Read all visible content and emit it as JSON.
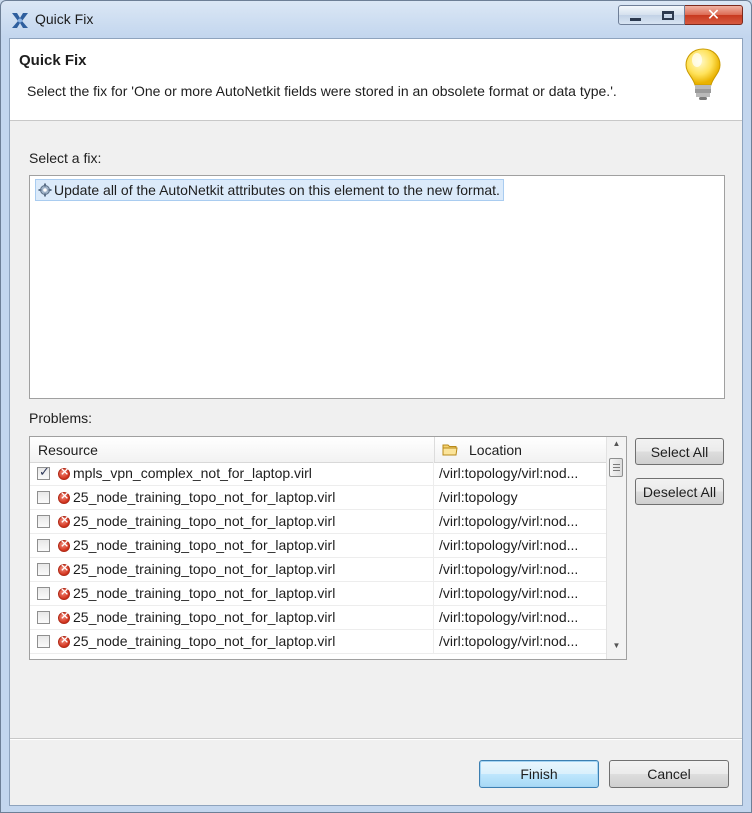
{
  "window": {
    "title": "Quick Fix"
  },
  "header": {
    "title": "Quick Fix",
    "description": "Select the fix for 'One or more AutoNetkit fields were stored in an obsolete format or data type.'."
  },
  "fixes": {
    "label": "Select a fix:",
    "items": [
      {
        "label": "Update all of the AutoNetkit attributes on this element to the new format.",
        "selected": true
      }
    ]
  },
  "problems": {
    "label": "Problems:",
    "columns": {
      "resource": "Resource",
      "location": "Location"
    },
    "rows": [
      {
        "checked": true,
        "resource": "mpls_vpn_complex_not_for_laptop.virl",
        "location": "/virl:topology/virl:nod..."
      },
      {
        "checked": false,
        "resource": "25_node_training_topo_not_for_laptop.virl",
        "location": "/virl:topology"
      },
      {
        "checked": false,
        "resource": "25_node_training_topo_not_for_laptop.virl",
        "location": "/virl:topology/virl:nod..."
      },
      {
        "checked": false,
        "resource": "25_node_training_topo_not_for_laptop.virl",
        "location": "/virl:topology/virl:nod..."
      },
      {
        "checked": false,
        "resource": "25_node_training_topo_not_for_laptop.virl",
        "location": "/virl:topology/virl:nod..."
      },
      {
        "checked": false,
        "resource": "25_node_training_topo_not_for_laptop.virl",
        "location": "/virl:topology/virl:nod..."
      },
      {
        "checked": false,
        "resource": "25_node_training_topo_not_for_laptop.virl",
        "location": "/virl:topology/virl:nod..."
      },
      {
        "checked": false,
        "resource": "25_node_training_topo_not_for_laptop.virl",
        "location": "/virl:topology/virl:nod..."
      }
    ],
    "select_all_label": "Select All",
    "deselect_all_label": "Deselect All"
  },
  "footer": {
    "finish_label": "Finish",
    "cancel_label": "Cancel"
  },
  "icons": {
    "app": "app-logo-icon",
    "header": "lightbulb-icon",
    "fix": "gear-icon",
    "location": "folder-icon",
    "problem": "error-icon"
  },
  "colors": {
    "selection": "#dbeafa",
    "error": "#d2321c",
    "default_button_border": "#3c7fb1"
  }
}
